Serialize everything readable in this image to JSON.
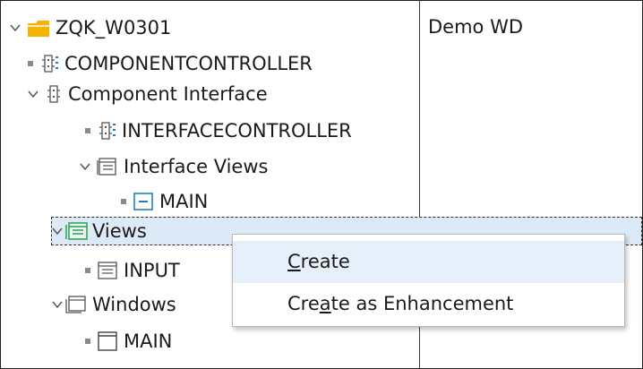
{
  "tree": {
    "root": {
      "label": "ZQK_W0301",
      "description": "Demo WD"
    },
    "component_controller": {
      "label": "COMPONENTCONTROLLER"
    },
    "component_interface": {
      "label": "Component Interface"
    },
    "interface_controller": {
      "label": "INTERFACECONTROLLER"
    },
    "interface_views": {
      "label": "Interface Views"
    },
    "interface_main": {
      "label": "MAIN"
    },
    "views": {
      "label": "Views"
    },
    "input_view": {
      "label": "INPUT"
    },
    "windows": {
      "label": "Windows"
    },
    "window_main": {
      "label": "MAIN"
    }
  },
  "context_menu": {
    "items": [
      {
        "label": "Create",
        "mnemonic": "C"
      },
      {
        "label": "Create as Enhancement",
        "mnemonic": "a"
      }
    ]
  },
  "colors": {
    "selection_bg": "#dceaf7",
    "folder": "#f5b400",
    "view_green": "#2e9e55",
    "accent_blue": "#1f7fc6"
  }
}
